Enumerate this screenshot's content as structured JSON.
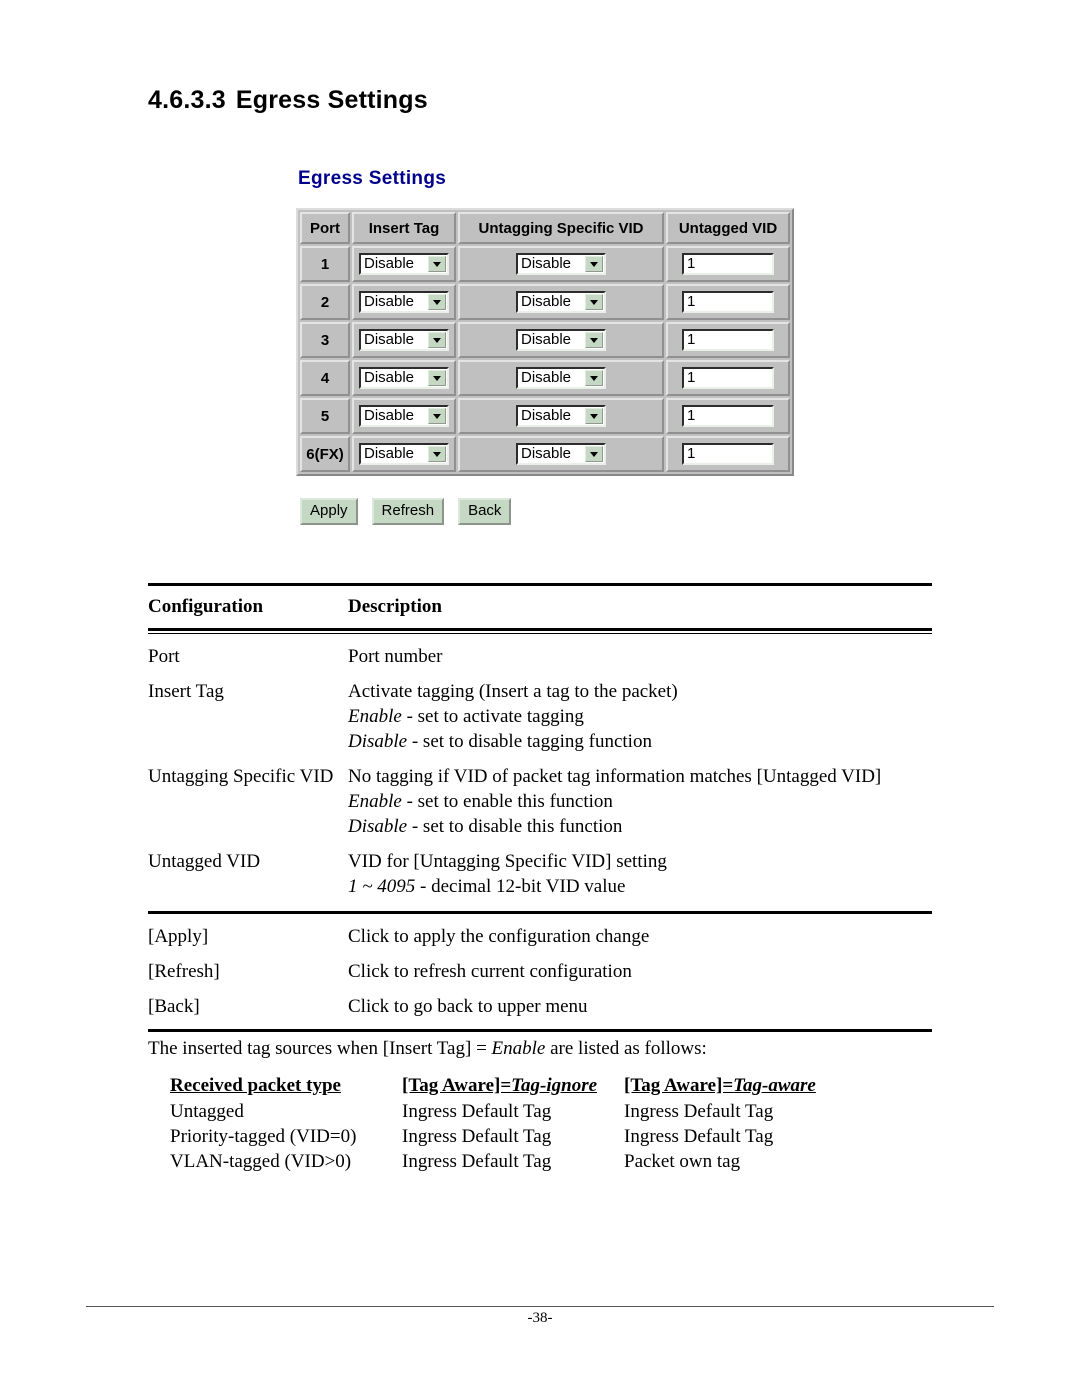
{
  "page": {
    "section_number": "4.6.3.3",
    "section_title": "Egress Settings",
    "footer_page": "-38-"
  },
  "ui_panel": {
    "title": "Egress Settings",
    "accent_color": "#00008b",
    "panel_bg": "#c0c0c0",
    "button_bg": "#c4d8c4",
    "columns": [
      "Port",
      "Insert Tag",
      "Untagging Specific VID",
      "Untagged VID"
    ],
    "rows": [
      {
        "port": "1",
        "insert_tag": "Disable",
        "untagging_specific_vid": "Disable",
        "untagged_vid": "1"
      },
      {
        "port": "2",
        "insert_tag": "Disable",
        "untagging_specific_vid": "Disable",
        "untagged_vid": "1"
      },
      {
        "port": "3",
        "insert_tag": "Disable",
        "untagging_specific_vid": "Disable",
        "untagged_vid": "1"
      },
      {
        "port": "4",
        "insert_tag": "Disable",
        "untagging_specific_vid": "Disable",
        "untagged_vid": "1"
      },
      {
        "port": "5",
        "insert_tag": "Disable",
        "untagging_specific_vid": "Disable",
        "untagged_vid": "1"
      },
      {
        "port": "6(FX)",
        "insert_tag": "Disable",
        "untagging_specific_vid": "Disable",
        "untagged_vid": "1"
      }
    ],
    "buttons": {
      "apply": "Apply",
      "refresh": "Refresh",
      "back": "Back"
    }
  },
  "config_table": {
    "header": {
      "config": "Configuration",
      "description": "Description"
    },
    "rows": [
      {
        "config": "Port",
        "lines": [
          {
            "text": "Port number"
          }
        ]
      },
      {
        "config": "Insert Tag",
        "lines": [
          {
            "text": "Activate tagging (Insert a tag to the packet)"
          },
          {
            "italic": "Enable",
            "text": " - set to activate tagging"
          },
          {
            "italic": "Disable",
            "text": " - set to disable tagging function"
          }
        ]
      },
      {
        "config": "Untagging Specific VID",
        "lines": [
          {
            "text": "No tagging if VID of packet tag information matches [Untagged VID]"
          },
          {
            "italic": "Enable",
            "text": " - set to enable this function"
          },
          {
            "italic": "Disable",
            "text": " - set to disable this function"
          }
        ]
      },
      {
        "config": "Untagged VID",
        "lines": [
          {
            "text": "VID for [Untagging Specific VID] setting"
          },
          {
            "italic": "1 ~ 4095",
            "text": " - decimal 12-bit VID value"
          }
        ]
      }
    ],
    "action_rows": [
      {
        "config": "[Apply]",
        "description": "Click to apply the configuration change"
      },
      {
        "config": "[Refresh]",
        "description": "Click to refresh current configuration"
      },
      {
        "config": "[Back]",
        "description": "Click to go back to upper menu"
      }
    ]
  },
  "tag_sources": {
    "intro_before": "The inserted tag sources when [Insert Tag] = ",
    "intro_italic": "Enable",
    "intro_after": " are listed as follows:",
    "headers": {
      "col1": "Received packet type",
      "col2_plain": "[Tag Aware]=",
      "col2_italic": "Tag-ignore",
      "col3_plain": "[Tag Aware]=",
      "col3_italic": "Tag-aware"
    },
    "rows": [
      {
        "type": "Untagged",
        "tag_ignore": "Ingress Default Tag",
        "tag_aware": "Ingress Default Tag"
      },
      {
        "type": "Priority-tagged (VID=0)",
        "tag_ignore": "Ingress Default Tag",
        "tag_aware": "Ingress Default Tag"
      },
      {
        "type": "VLAN-tagged (VID>0)",
        "tag_ignore": "Ingress Default Tag",
        "tag_aware": "Packet own tag"
      }
    ]
  }
}
